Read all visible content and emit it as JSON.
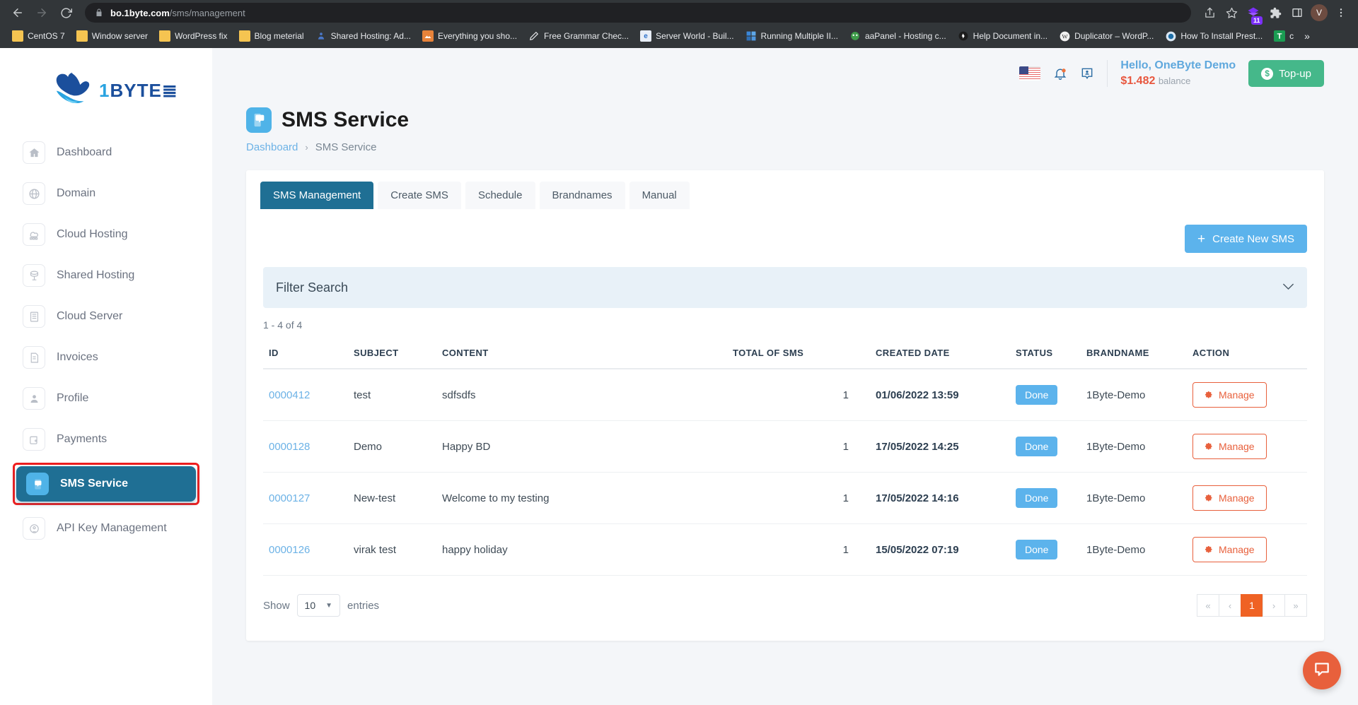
{
  "browser": {
    "url_domain": "bo.1byte.com",
    "url_path": "/sms/management",
    "back_icon": "back-arrow-icon",
    "forward_icon": "forward-arrow-icon",
    "reload_icon": "reload-icon",
    "share_icon": "share-icon",
    "bookmark_star_icon": "star-icon",
    "extension_badge": "11",
    "profile_initial": "V",
    "bookmarks": [
      {
        "label": "CentOS 7",
        "icon": "folder-icon"
      },
      {
        "label": "Window server",
        "icon": "folder-icon"
      },
      {
        "label": "WordPress fix",
        "icon": "folder-icon"
      },
      {
        "label": "Blog meterial",
        "icon": "folder-icon"
      },
      {
        "label": "Shared Hosting: Ad...",
        "icon": "site-icon"
      },
      {
        "label": "Everything you sho...",
        "icon": "image-icon"
      },
      {
        "label": "Free Grammar Chec...",
        "icon": "pen-icon"
      },
      {
        "label": "Server World - Buil...",
        "icon": "ie-icon"
      },
      {
        "label": "Running Multiple II...",
        "icon": "windows-icon"
      },
      {
        "label": "aaPanel - Hosting c...",
        "icon": "aapanel-icon"
      },
      {
        "label": "Help Document in...",
        "icon": "help-icon"
      },
      {
        "label": "Duplicator – WordP...",
        "icon": "wordpress-icon"
      },
      {
        "label": "How To Install Prest...",
        "icon": "prestashop-icon"
      },
      {
        "label": "c",
        "icon": "sheets-icon"
      }
    ],
    "overflow_label": "»"
  },
  "sidebar": {
    "logo_one": "1",
    "logo_rest": "BYTE",
    "items": [
      {
        "label": "Dashboard",
        "icon": "home-icon",
        "active": false
      },
      {
        "label": "Domain",
        "icon": "globe-icon",
        "active": false
      },
      {
        "label": "Cloud Hosting",
        "icon": "cloud-hosting-icon",
        "active": false
      },
      {
        "label": "Shared Hosting",
        "icon": "server-icon",
        "active": false
      },
      {
        "label": "Cloud Server",
        "icon": "rack-icon",
        "active": false
      },
      {
        "label": "Invoices",
        "icon": "invoice-icon",
        "active": false
      },
      {
        "label": "Profile",
        "icon": "user-icon",
        "active": false
      },
      {
        "label": "Payments",
        "icon": "wallet-icon",
        "active": false
      },
      {
        "label": "SMS Service",
        "icon": "sms-icon",
        "active": true
      },
      {
        "label": "API Key Management",
        "icon": "api-key-icon",
        "active": false
      }
    ]
  },
  "topbar": {
    "flag_icon": "us-flag-icon",
    "bell_icon": "notification-bell-icon",
    "support_icon": "support-contact-icon",
    "greeting": "Hello, OneByte Demo",
    "balance_amount": "$1.482",
    "balance_label": "balance",
    "topup_label": "Top-up",
    "topup_color": "#45b88a"
  },
  "page": {
    "icon": "sms-page-icon",
    "title": "SMS Service",
    "breadcrumb_home": "Dashboard",
    "breadcrumb_sep": "›",
    "breadcrumb_current": "SMS Service"
  },
  "tabs": [
    {
      "label": "SMS Management",
      "active": true
    },
    {
      "label": "Create SMS",
      "active": false
    },
    {
      "label": "Schedule",
      "active": false
    },
    {
      "label": "Brandnames",
      "active": false
    },
    {
      "label": "Manual",
      "active": false
    }
  ],
  "toolbar": {
    "create_new_sms": "Create New SMS",
    "create_plus": "+",
    "create_color": "#5cb3ec"
  },
  "filter": {
    "label": "Filter Search",
    "chevron_icon": "chevron-down-icon"
  },
  "table": {
    "count_text": "1 - 4 of 4",
    "headers": {
      "id": "ID",
      "subject": "SUBJECT",
      "content": "CONTENT",
      "total": "TOTAL OF SMS",
      "date": "CREATED DATE",
      "status": "STATUS",
      "brandname": "BRANDNAME",
      "action": "ACTION"
    },
    "rows": [
      {
        "id": "0000412",
        "subject": "test",
        "content": "sdfsdfs",
        "total": "1",
        "date": "01/06/2022 13:59",
        "status": "Done",
        "brandname": "1Byte-Demo",
        "action": "Manage"
      },
      {
        "id": "0000128",
        "subject": "Demo",
        "content": "Happy BD",
        "total": "1",
        "date": "17/05/2022 14:25",
        "status": "Done",
        "brandname": "1Byte-Demo",
        "action": "Manage"
      },
      {
        "id": "0000127",
        "subject": "New-test",
        "content": "Welcome to my testing",
        "total": "1",
        "date": "17/05/2022 14:16",
        "status": "Done",
        "brandname": "1Byte-Demo",
        "action": "Manage"
      },
      {
        "id": "0000126",
        "subject": "virak test",
        "content": "happy holiday",
        "total": "1",
        "date": "15/05/2022 07:19",
        "status": "Done",
        "brandname": "1Byte-Demo",
        "action": "Manage"
      }
    ],
    "status_color": "#5cb3ec",
    "action_color": "#e8603c"
  },
  "footer": {
    "show_label": "Show",
    "entries_value": "10",
    "entries_label": "entries",
    "pager": {
      "first": "«",
      "prev": "‹",
      "current": "1",
      "next": "›",
      "last": "»"
    }
  },
  "chat": {
    "icon": "chat-bubble-icon",
    "color": "#e8603c"
  }
}
